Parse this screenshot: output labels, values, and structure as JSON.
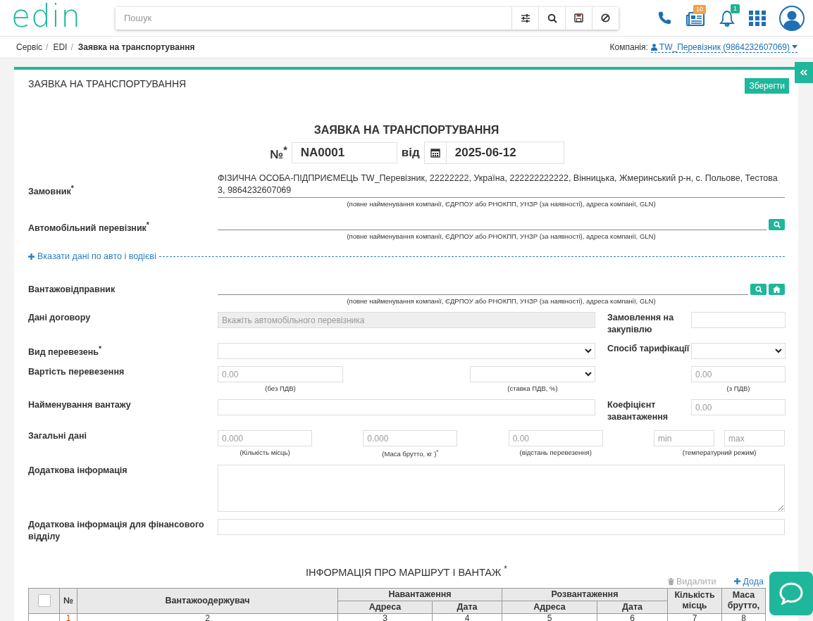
{
  "header": {
    "logo": "edin",
    "search_placeholder": "Пошук",
    "news_badge": "10",
    "notifications_badge": "1"
  },
  "breadcrumbs": [
    {
      "label": "Сервіс",
      "current": false,
      "separator": "/"
    },
    {
      "label": "EDI",
      "current": false,
      "separator": "/"
    },
    {
      "label": "Заявка на транспортування",
      "current": true
    }
  ],
  "company": {
    "label": "Компанія:",
    "value": "TW_Перевізник (9864232607069)"
  },
  "page_title": "ЗАЯВКА НА ТРАНСПОРТУВАННЯ",
  "save_button": "Зберегти",
  "document": {
    "title": "ЗАЯВКА НА ТРАНСПОРТУВАННЯ",
    "number_label": "№$^{*}$",
    "number": "NA0001",
    "date_label": "від",
    "date": "2025-06-12"
  },
  "customer": {
    "label": "Замовник$^{*}$",
    "value": "ФІЗИЧНА ОСОБА-ПІДПРИЄМЕЦЬ TW_Перевізник, 22222222, Україна, 222222222222, Вінницька, Жмеринський р-н, с. Польове, Тестова 3, 9864232607069",
    "hint": "(повне найменування компанії, ЄДРПОУ або РНОКПП, УНЗР (за наявності), адреса компанії, GLN)"
  },
  "carrier": {
    "label": "Автомобільний перевізник$^{*}$",
    "hint": "(повне найменування компанії, ЄДРПОУ або РНОКПП, УНЗР (за наявності), адреса компанії, GLN)"
  },
  "vehicle_link": "Вказати дані по авто і водієві",
  "shipper": {
    "label": "Вантажовідправник",
    "hint": "(повне найменування компанії, ЄДРПОУ або РНОКПП, УНЗР (за наявності), адреса компанії, GLN)"
  },
  "contract": {
    "label": "Дані договору",
    "placeholder": "Вкажіть автомобільного перевізника",
    "disabled": true
  },
  "purchase_order": {
    "label": "Замовлення на закупівлю"
  },
  "transport_type": {
    "label": "Вид перевезень$^{*}$"
  },
  "tariff_method": {
    "label": "Спосіб тарифікації"
  },
  "cost": {
    "label": "Вартість перевезення",
    "net": {
      "placeholder": "0.00",
      "hint": "(без ПДВ)"
    },
    "vat_hint": "(ставка ПДВ, %)",
    "gross": {
      "placeholder": "0.00",
      "hint": "(з ПДВ)"
    }
  },
  "cargo_name": {
    "label": "Найменування вантажу"
  },
  "load_factor": {
    "label": "Коефіцієнт завантаження",
    "placeholder": "0.00"
  },
  "general": {
    "label": "Загальні дані",
    "items": [
      {
        "placeholder": "0.000",
        "hint": "(Кількість місць)"
      },
      {
        "placeholder": "0.000",
        "hint": "(Маса брутто, кг )$^{*}$"
      },
      {
        "placeholder": "0.00",
        "hint": "(відстань перевезення)"
      }
    ],
    "temperature": {
      "min_placeholder": "min",
      "max_placeholder": "max",
      "hint": "(температурний режим)"
    }
  },
  "additional_info": {
    "label": "Додаткова інформація"
  },
  "finance_info": {
    "label": "Додаткова інформація для фінансового відділу"
  },
  "route": {
    "title": "ІНФОРМАЦІЯ ПРО МАРШРУТ І ВАНТАЖ $^{*}$",
    "delete_button": {
      "label": "Видалити",
      "disabled": true
    },
    "add_button": "Дода",
    "table": {
      "select_all_checked": false,
      "number_header": "№",
      "consignee_header": "Вантажоодержувач",
      "groups": [
        {
          "label": "Навантаження",
          "subcolumns": [
            "Адреса",
            "Дата"
          ]
        },
        {
          "label": "Розвантаження",
          "subcolumns": [
            "Адреса",
            "Дата"
          ]
        }
      ],
      "places_header": "Кількість місць",
      "mass_header": "Маса брутто,",
      "index_row": [
        "1",
        "2",
        "3",
        "4",
        "5",
        "6",
        "7",
        "8"
      ]
    }
  }
}
